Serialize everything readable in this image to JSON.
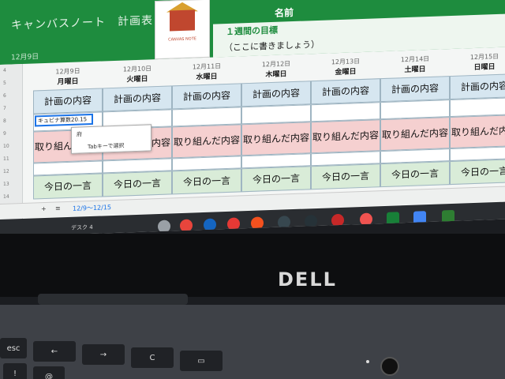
{
  "sheet": {
    "title": "キャンバスノート　計画表",
    "date": "12月9日",
    "logo_text": "CANVAS NOTE",
    "name_label": "名前",
    "goal_label": "１週間の目標",
    "goal_text": "（ここに書きましょう）"
  },
  "days": [
    {
      "date": "12月9日",
      "weekday": "月曜日"
    },
    {
      "date": "12月10日",
      "weekday": "火曜日"
    },
    {
      "date": "12月11日",
      "weekday": "水曜日"
    },
    {
      "date": "12月12日",
      "weekday": "木曜日"
    },
    {
      "date": "12月13日",
      "weekday": "金曜日"
    },
    {
      "date": "12月14日",
      "weekday": "土曜日"
    },
    {
      "date": "12月15日",
      "weekday": "日曜日"
    }
  ],
  "rows": {
    "plan": "計画の内容",
    "done": "取り組んだ内容",
    "word": "今日の一言"
  },
  "editing": {
    "cell_text": "キュビナ算数20.15",
    "suggest_1": "府",
    "suggest_2": "Tabキーで選択"
  },
  "tabs": {
    "add": "+",
    "menu": "≡",
    "active": "12/9〜12/15"
  },
  "taskbar": {
    "desk": "デスク 4"
  },
  "laptop": {
    "brand": "DELL",
    "keys": [
      "esc",
      "←",
      "→",
      "C",
      "▭",
      "!",
      "@"
    ]
  }
}
